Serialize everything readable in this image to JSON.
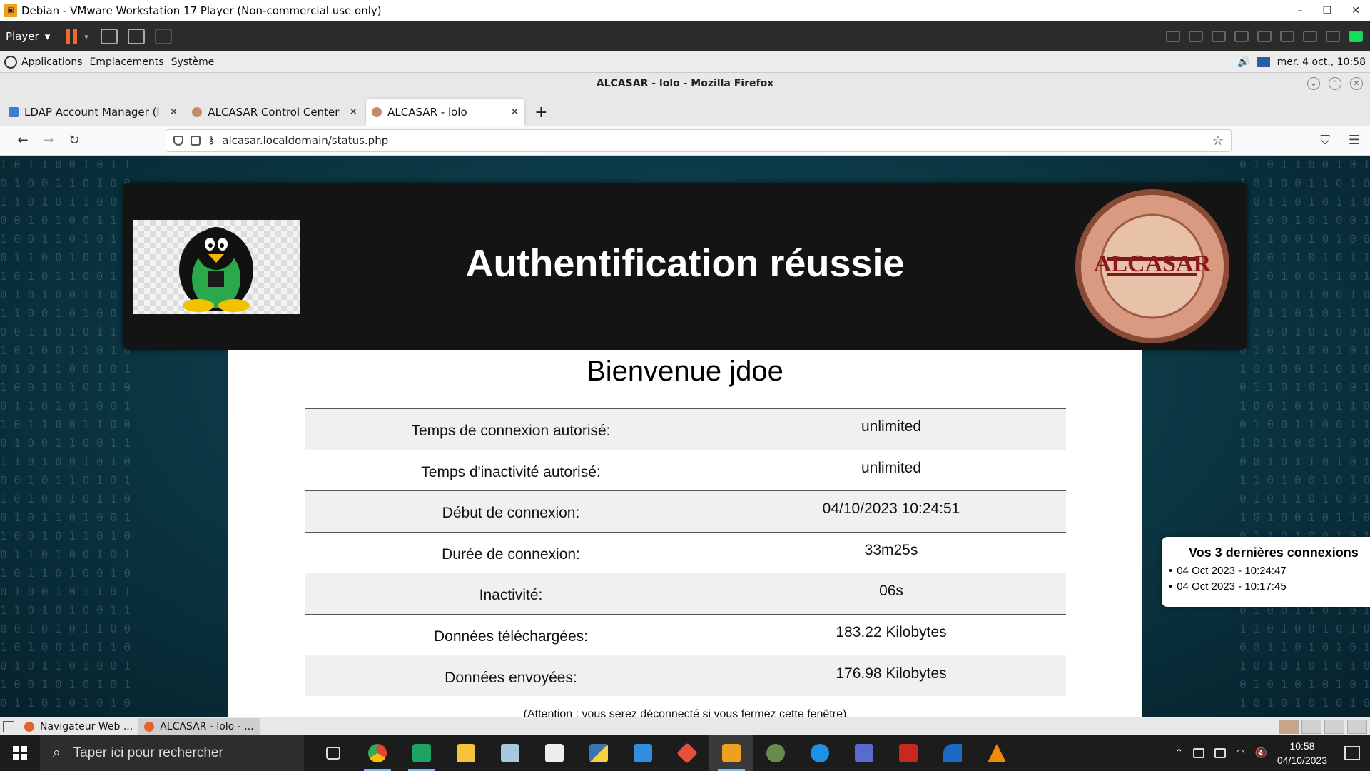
{
  "vm": {
    "title": "Debian - VMware Workstation 17 Player (Non-commercial use only)",
    "player_menu": "Player",
    "controls": [
      "–",
      "❐",
      "✕"
    ]
  },
  "guest_panel": {
    "menus": [
      "Applications",
      "Emplacements",
      "Système"
    ],
    "clock": "mer.  4 oct., 10:58"
  },
  "firefox": {
    "window_title": "ALCASAR - lolo - Mozilla Firefox",
    "tabs": [
      {
        "label": "LDAP Account Manager (l"
      },
      {
        "label": "ALCASAR Control Center"
      },
      {
        "label": "ALCASAR - lolo"
      }
    ],
    "url": "alcasar.localdomain/status.php"
  },
  "page": {
    "header_title": "Authentification réussie",
    "seal_text": "ALCASAR",
    "welcome": "Bienvenue jdoe",
    "rows": [
      {
        "label": "Temps de connexion autorisé:",
        "value": "unlimited"
      },
      {
        "label": "Temps d'inactivité autorisé:",
        "value": "unlimited"
      },
      {
        "label": "Début de connexion:",
        "value": "04/10/2023 10:24:51"
      },
      {
        "label": "Durée de connexion:",
        "value": "33m25s"
      },
      {
        "label": "Inactivité:",
        "value": "06s"
      },
      {
        "label": "Données téléchargées:",
        "value": "183.22 Kilobytes"
      },
      {
        "label": "Données envoyées:",
        "value": "176.98 Kilobytes"
      }
    ],
    "warning": "(Attention : vous serez déconnecté si vous fermez cette fenêtre)",
    "last_connections": {
      "title": "Vos 3 dernières connexions",
      "items": [
        "04 Oct 2023 - 10:24:47",
        "04 Oct 2023 - 10:17:45"
      ]
    }
  },
  "guest_bottom": {
    "tasks": [
      "Navigateur Web ...",
      "ALCASAR - lolo - ..."
    ]
  },
  "taskbar": {
    "search_placeholder": "Taper ici pour rechercher",
    "time": "10:58",
    "date": "04/10/2023"
  }
}
